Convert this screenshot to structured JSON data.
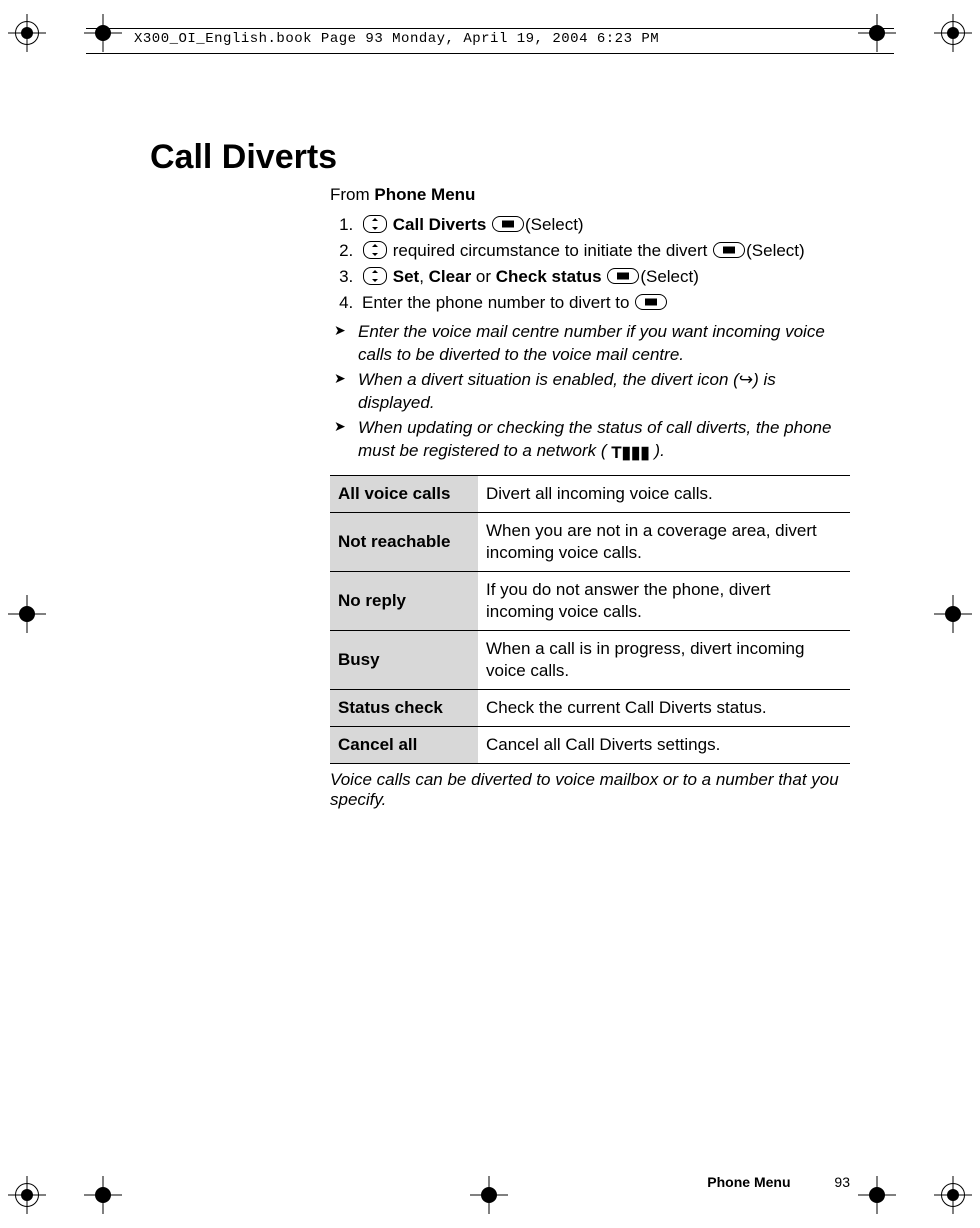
{
  "header": {
    "running_title": "X300_OI_English.book  Page 93  Monday, April 19, 2004  6:23 PM"
  },
  "page_title": "Call Diverts",
  "from_prefix": "From ",
  "from_menu": "Phone Menu",
  "steps": [
    {
      "num": "1.",
      "pre": "",
      "bold": "Call Diverts",
      "post": "(Select)",
      "nav": true,
      "soft": true
    },
    {
      "num": "2.",
      "pre": "required circumstance to initiate the divert ",
      "bold": "",
      "post": "(Select)",
      "nav": true,
      "soft": true
    },
    {
      "num": "3.",
      "pre": "",
      "bold": "Set",
      "mid": ", ",
      "bold2": "Clear",
      "mid2": " or ",
      "bold3": "Check status",
      "post": "(Select)",
      "nav": true,
      "soft": true
    },
    {
      "num": "4.",
      "pre": "Enter the phone number to divert to ",
      "bold": "",
      "post": "",
      "nav": false,
      "soft": true
    }
  ],
  "notes": [
    "Enter the voice mail centre number if you want incoming voice calls to be diverted to the voice mail centre.",
    "When a divert situation is enabled, the divert icon (↪) is displayed.",
    "When updating or checking the status of call diverts, the phone must be registered to a network ( ▮▮▮▮ )."
  ],
  "note2_parts": {
    "pre": "When a divert situation is enabled, the divert icon (",
    "glyph": "↪",
    "post": ") is displayed."
  },
  "note3_parts": {
    "pre": "When updating or checking the status of call diverts, the phone must be registered to a network ( ",
    "glyph": "▝▞𝄃",
    "post": " )."
  },
  "table": [
    {
      "label": "All voice calls",
      "desc": "Divert all incoming voice calls."
    },
    {
      "label": "Not reachable",
      "desc": "When you are not in a coverage area, divert incoming voice calls."
    },
    {
      "label": "No reply",
      "desc": "If you do not answer the phone, divert incoming voice calls."
    },
    {
      "label": "Busy",
      "desc": "When a call is in progress, divert incoming voice calls."
    },
    {
      "label": "Status check",
      "desc": "Check the current Call Diverts status."
    },
    {
      "label": "Cancel all",
      "desc": "Cancel all Call Diverts settings."
    }
  ],
  "below_table": "Voice calls can be diverted to voice mailbox or to a number that you specify.",
  "footer": {
    "section": "Phone Menu",
    "page": "93"
  }
}
